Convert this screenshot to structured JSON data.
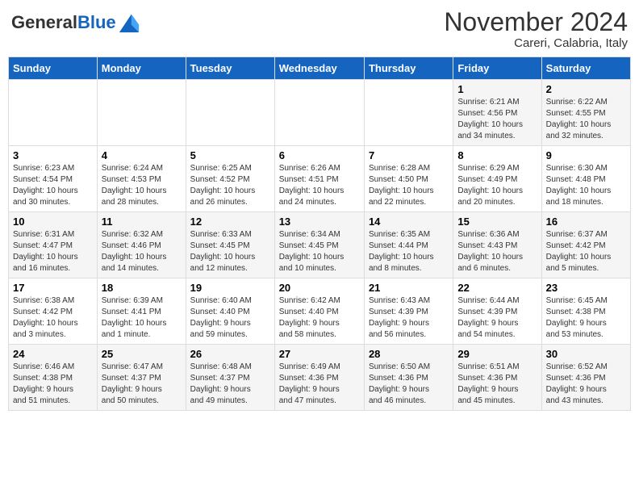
{
  "header": {
    "logo_general": "General",
    "logo_blue": "Blue",
    "month_title": "November 2024",
    "location": "Careri, Calabria, Italy"
  },
  "days_of_week": [
    "Sunday",
    "Monday",
    "Tuesday",
    "Wednesday",
    "Thursday",
    "Friday",
    "Saturday"
  ],
  "weeks": [
    [
      {
        "num": "",
        "info": ""
      },
      {
        "num": "",
        "info": ""
      },
      {
        "num": "",
        "info": ""
      },
      {
        "num": "",
        "info": ""
      },
      {
        "num": "",
        "info": ""
      },
      {
        "num": "1",
        "info": "Sunrise: 6:21 AM\nSunset: 4:56 PM\nDaylight: 10 hours\nand 34 minutes."
      },
      {
        "num": "2",
        "info": "Sunrise: 6:22 AM\nSunset: 4:55 PM\nDaylight: 10 hours\nand 32 minutes."
      }
    ],
    [
      {
        "num": "3",
        "info": "Sunrise: 6:23 AM\nSunset: 4:54 PM\nDaylight: 10 hours\nand 30 minutes."
      },
      {
        "num": "4",
        "info": "Sunrise: 6:24 AM\nSunset: 4:53 PM\nDaylight: 10 hours\nand 28 minutes."
      },
      {
        "num": "5",
        "info": "Sunrise: 6:25 AM\nSunset: 4:52 PM\nDaylight: 10 hours\nand 26 minutes."
      },
      {
        "num": "6",
        "info": "Sunrise: 6:26 AM\nSunset: 4:51 PM\nDaylight: 10 hours\nand 24 minutes."
      },
      {
        "num": "7",
        "info": "Sunrise: 6:28 AM\nSunset: 4:50 PM\nDaylight: 10 hours\nand 22 minutes."
      },
      {
        "num": "8",
        "info": "Sunrise: 6:29 AM\nSunset: 4:49 PM\nDaylight: 10 hours\nand 20 minutes."
      },
      {
        "num": "9",
        "info": "Sunrise: 6:30 AM\nSunset: 4:48 PM\nDaylight: 10 hours\nand 18 minutes."
      }
    ],
    [
      {
        "num": "10",
        "info": "Sunrise: 6:31 AM\nSunset: 4:47 PM\nDaylight: 10 hours\nand 16 minutes."
      },
      {
        "num": "11",
        "info": "Sunrise: 6:32 AM\nSunset: 4:46 PM\nDaylight: 10 hours\nand 14 minutes."
      },
      {
        "num": "12",
        "info": "Sunrise: 6:33 AM\nSunset: 4:45 PM\nDaylight: 10 hours\nand 12 minutes."
      },
      {
        "num": "13",
        "info": "Sunrise: 6:34 AM\nSunset: 4:45 PM\nDaylight: 10 hours\nand 10 minutes."
      },
      {
        "num": "14",
        "info": "Sunrise: 6:35 AM\nSunset: 4:44 PM\nDaylight: 10 hours\nand 8 minutes."
      },
      {
        "num": "15",
        "info": "Sunrise: 6:36 AM\nSunset: 4:43 PM\nDaylight: 10 hours\nand 6 minutes."
      },
      {
        "num": "16",
        "info": "Sunrise: 6:37 AM\nSunset: 4:42 PM\nDaylight: 10 hours\nand 5 minutes."
      }
    ],
    [
      {
        "num": "17",
        "info": "Sunrise: 6:38 AM\nSunset: 4:42 PM\nDaylight: 10 hours\nand 3 minutes."
      },
      {
        "num": "18",
        "info": "Sunrise: 6:39 AM\nSunset: 4:41 PM\nDaylight: 10 hours\nand 1 minute."
      },
      {
        "num": "19",
        "info": "Sunrise: 6:40 AM\nSunset: 4:40 PM\nDaylight: 9 hours\nand 59 minutes."
      },
      {
        "num": "20",
        "info": "Sunrise: 6:42 AM\nSunset: 4:40 PM\nDaylight: 9 hours\nand 58 minutes."
      },
      {
        "num": "21",
        "info": "Sunrise: 6:43 AM\nSunset: 4:39 PM\nDaylight: 9 hours\nand 56 minutes."
      },
      {
        "num": "22",
        "info": "Sunrise: 6:44 AM\nSunset: 4:39 PM\nDaylight: 9 hours\nand 54 minutes."
      },
      {
        "num": "23",
        "info": "Sunrise: 6:45 AM\nSunset: 4:38 PM\nDaylight: 9 hours\nand 53 minutes."
      }
    ],
    [
      {
        "num": "24",
        "info": "Sunrise: 6:46 AM\nSunset: 4:38 PM\nDaylight: 9 hours\nand 51 minutes."
      },
      {
        "num": "25",
        "info": "Sunrise: 6:47 AM\nSunset: 4:37 PM\nDaylight: 9 hours\nand 50 minutes."
      },
      {
        "num": "26",
        "info": "Sunrise: 6:48 AM\nSunset: 4:37 PM\nDaylight: 9 hours\nand 49 minutes."
      },
      {
        "num": "27",
        "info": "Sunrise: 6:49 AM\nSunset: 4:36 PM\nDaylight: 9 hours\nand 47 minutes."
      },
      {
        "num": "28",
        "info": "Sunrise: 6:50 AM\nSunset: 4:36 PM\nDaylight: 9 hours\nand 46 minutes."
      },
      {
        "num": "29",
        "info": "Sunrise: 6:51 AM\nSunset: 4:36 PM\nDaylight: 9 hours\nand 45 minutes."
      },
      {
        "num": "30",
        "info": "Sunrise: 6:52 AM\nSunset: 4:36 PM\nDaylight: 9 hours\nand 43 minutes."
      }
    ]
  ]
}
